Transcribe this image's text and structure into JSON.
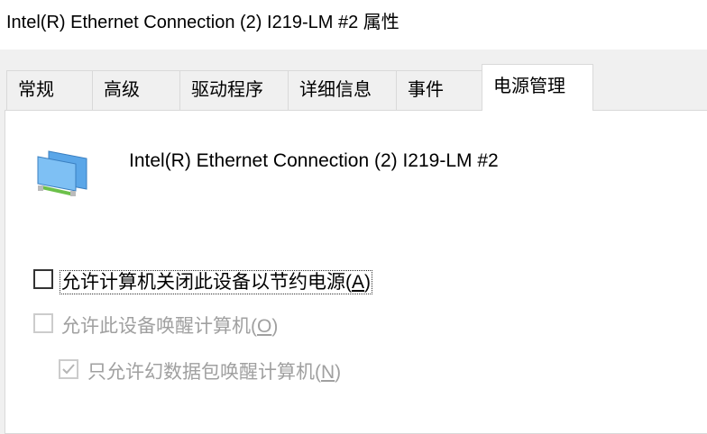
{
  "window": {
    "title": "Intel(R) Ethernet Connection (2) I219-LM #2 属性"
  },
  "tabs": [
    {
      "label": "常规",
      "active": false
    },
    {
      "label": "高级",
      "active": false
    },
    {
      "label": "驱动程序",
      "active": false
    },
    {
      "label": "详细信息",
      "active": false
    },
    {
      "label": "事件",
      "active": false
    },
    {
      "label": "电源管理",
      "active": true
    }
  ],
  "device": {
    "name": "Intel(R) Ethernet Connection (2) I219-LM #2",
    "icon": "network-adapter-icon"
  },
  "options": [
    {
      "label": "允许计算机关闭此设备以节约电源",
      "accel": "A",
      "checked": false,
      "enabled": true
    },
    {
      "label": "允许此设备唤醒计算机",
      "accel": "O",
      "checked": false,
      "enabled": false
    },
    {
      "label": "只允许幻数据包唤醒计算机",
      "accel": "N",
      "checked": true,
      "enabled": false
    }
  ]
}
